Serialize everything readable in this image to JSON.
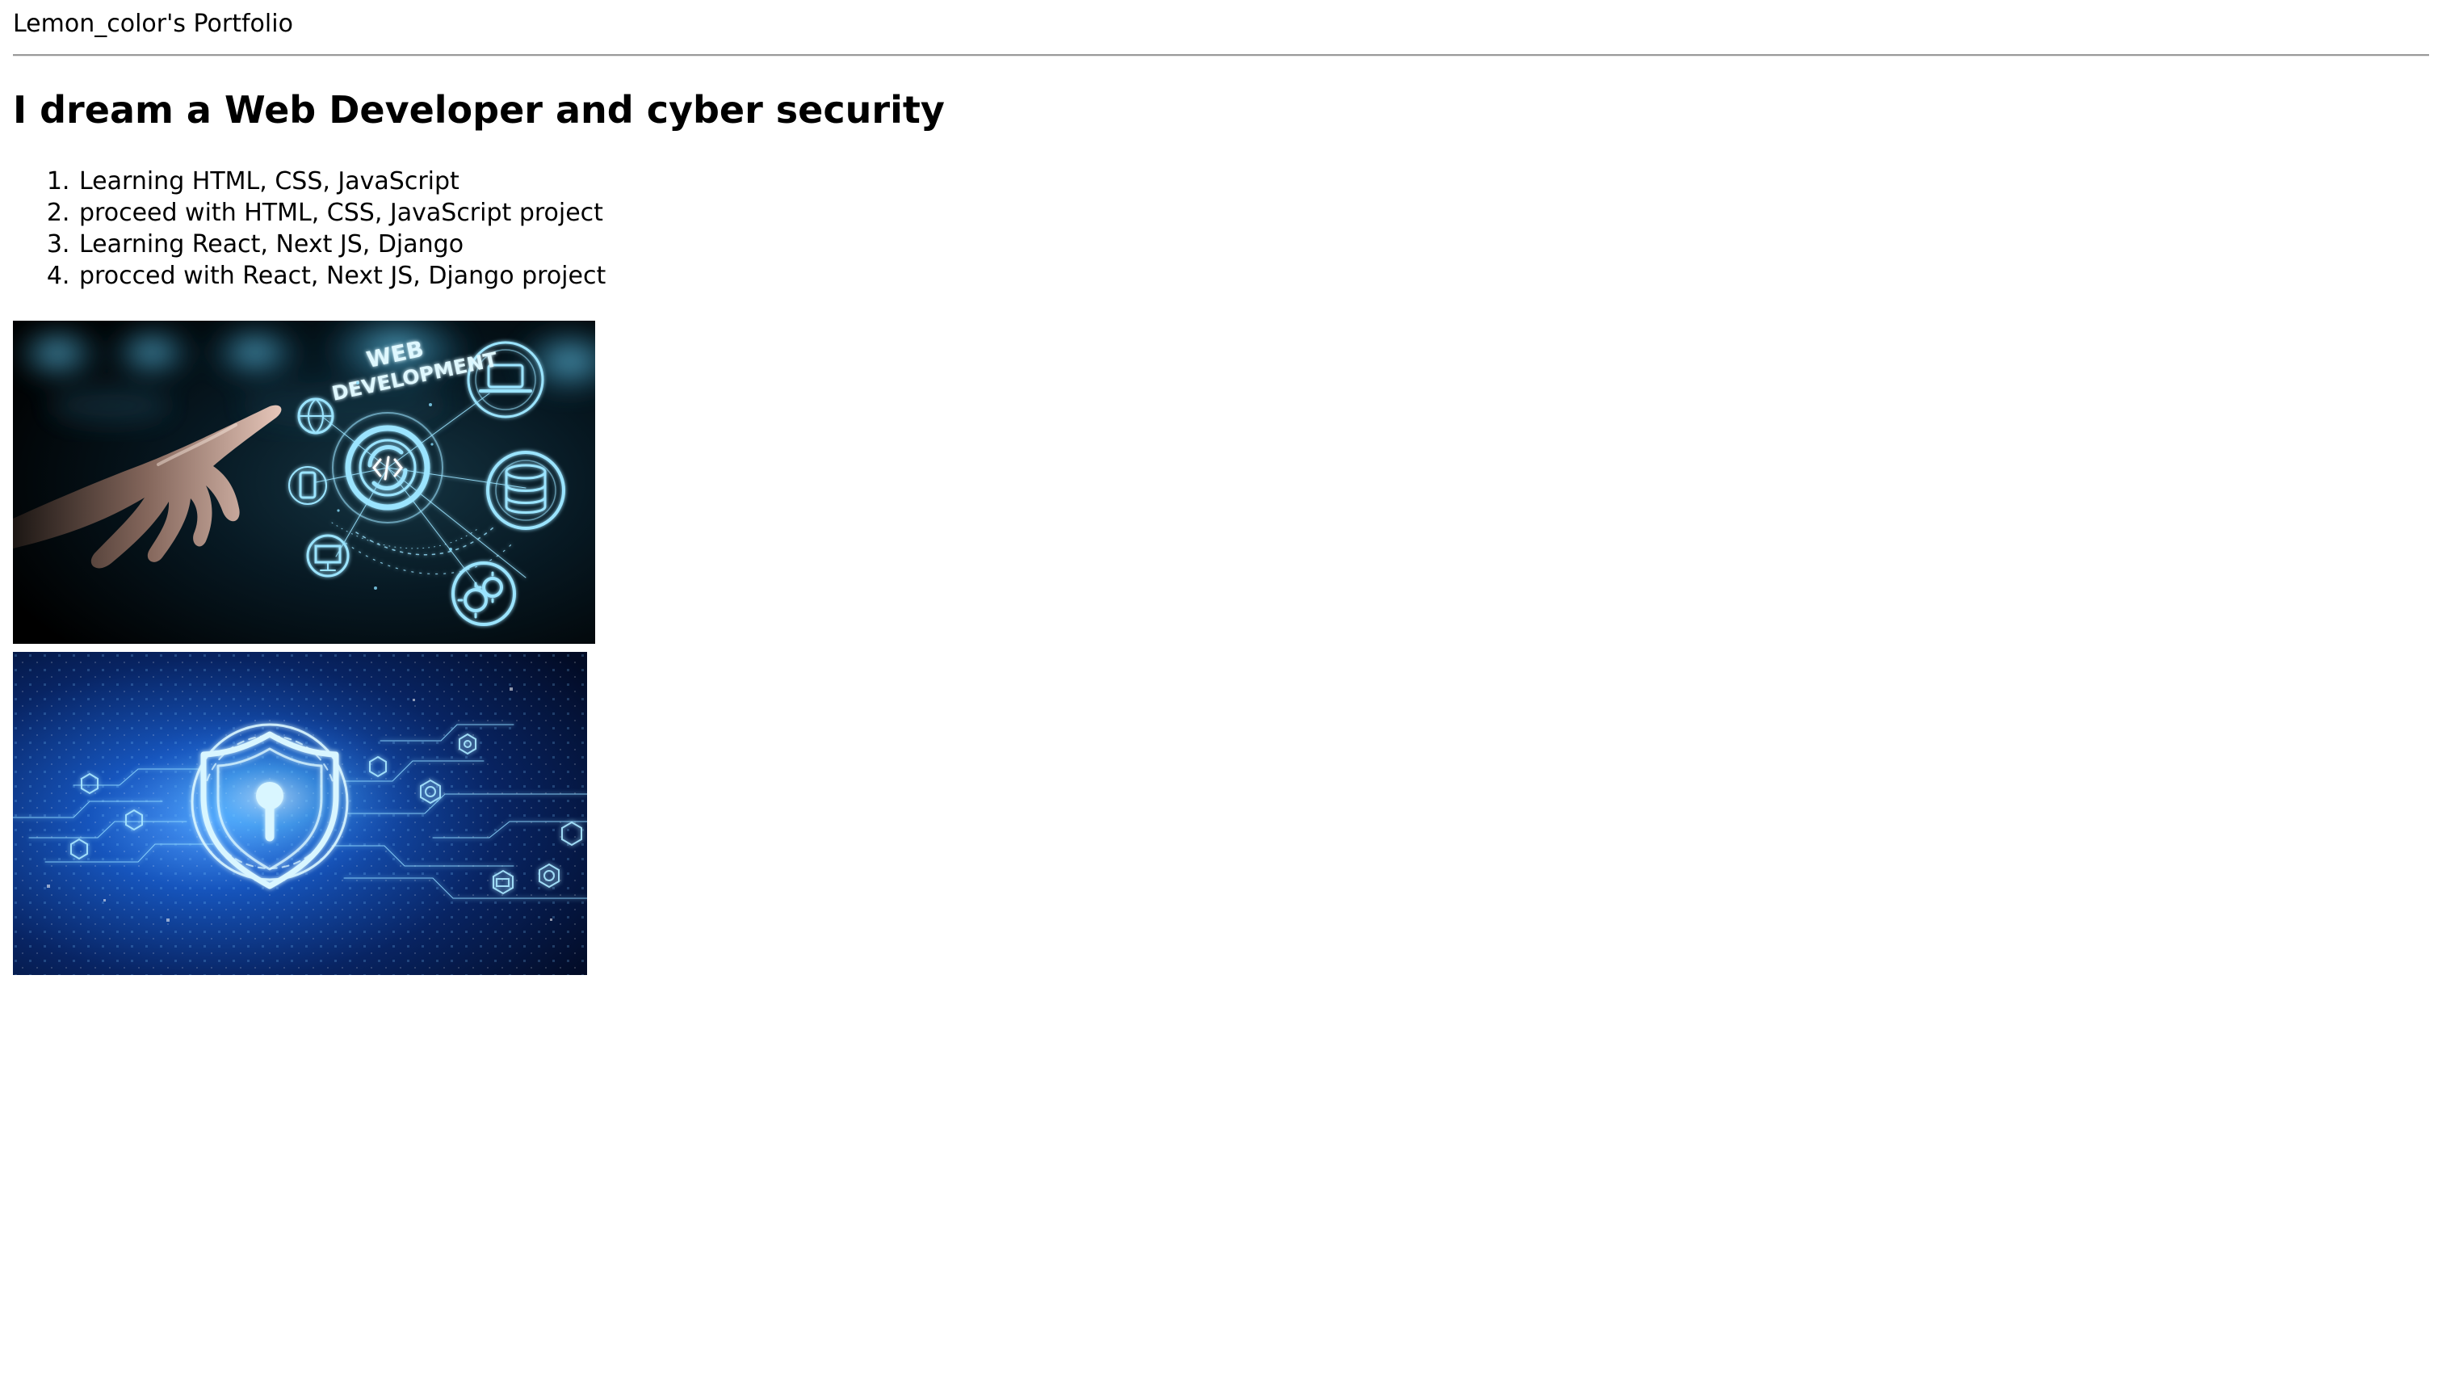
{
  "page": {
    "site_title": "Lemon_color's Portfolio",
    "headline": "I dream a Web Developer and cyber security",
    "goals": [
      "Learning HTML, CSS, JavaScript",
      "proceed with HTML, CSS, JavaScript project",
      "Learning React, Next JS, Django",
      "procced with React, Next JS, Django project"
    ]
  },
  "images": {
    "web_development": {
      "text_line_1": "WEB",
      "text_line_2": "DEVELOPMENT",
      "icons": [
        "hand-icon",
        "code-gear-icon",
        "laptop-icon",
        "database-icon",
        "globe-icon",
        "tablet-icon",
        "monitor-icon",
        "gears-icon"
      ]
    },
    "cyber_security": {
      "icons": [
        "shield-lock-icon",
        "circuit-icon",
        "network-node-icon"
      ]
    }
  },
  "colors": {
    "text": "#000000",
    "background": "#ffffff",
    "divider": "#9a9a9a",
    "web_glow": "#73d4ff",
    "security_glow": "#6fb8ff"
  }
}
